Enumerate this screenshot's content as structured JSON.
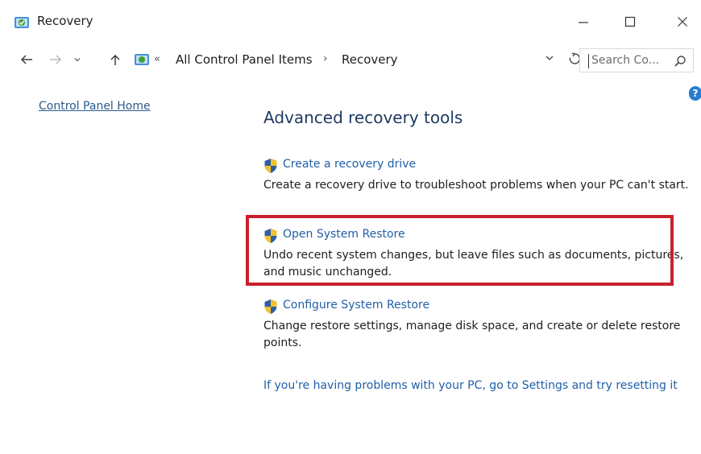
{
  "window": {
    "title": "Recovery"
  },
  "address_bar": {
    "overflow_glyph": "«",
    "crumbs": [
      "All Control Panel Items",
      "Recovery"
    ],
    "separator": "›"
  },
  "search": {
    "placeholder": "Search Co..."
  },
  "sidebar": {
    "home_link": "Control Panel Home"
  },
  "main": {
    "heading": "Advanced recovery tools",
    "items": [
      {
        "title": "Create a recovery drive",
        "description": "Create a recovery drive to troubleshoot problems when your PC can't start."
      },
      {
        "title": "Open System Restore",
        "description": "Undo recent system changes, but leave files such as documents, pictures, and music unchanged."
      },
      {
        "title": "Configure System Restore",
        "description": "Change restore settings, manage disk space, and create or delete restore points."
      }
    ],
    "settings_link": "If you're having problems with your PC, go to Settings and try resetting it"
  },
  "help": {
    "glyph": "?"
  },
  "colors": {
    "link": "#1f5fa8",
    "highlight": "#c9202d",
    "heading": "#1e3a5f",
    "help_icon": "#2a7bd2"
  }
}
